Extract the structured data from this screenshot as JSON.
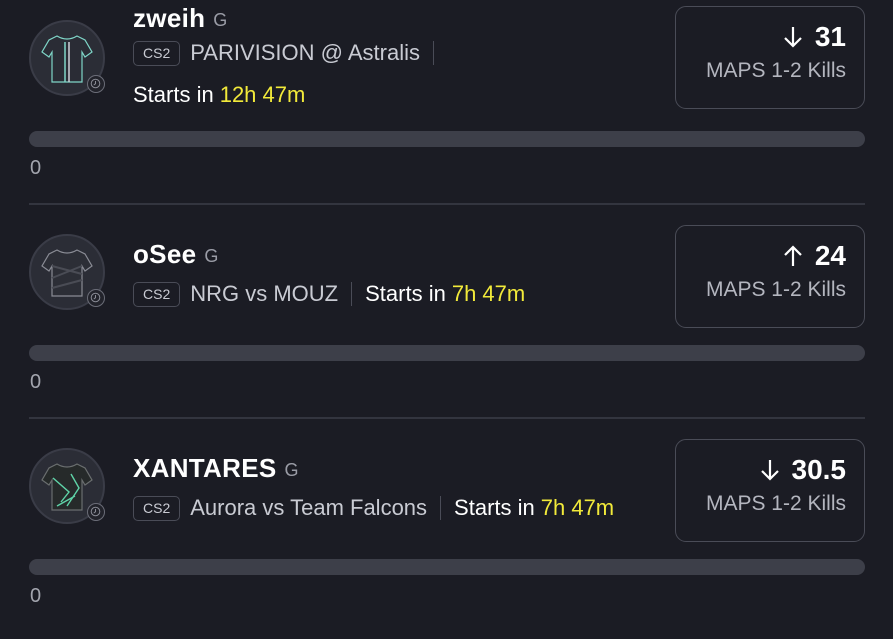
{
  "players": [
    {
      "name": "zweih",
      "position": "G",
      "game": "CS2",
      "matchup": "PARIVISION @ Astralis",
      "starts_label": "Starts in",
      "starts_time": "12h 47m",
      "direction": "down",
      "line": "31",
      "stat": "MAPS 1-2 Kills",
      "progress": 0,
      "count": "0",
      "jersey_colors": {
        "body": "#2a2c35",
        "accent": "#7fd6c8"
      }
    },
    {
      "name": "oSee",
      "position": "G",
      "game": "CS2",
      "matchup": "NRG vs MOUZ",
      "starts_label": "Starts in",
      "starts_time": "7h 47m",
      "direction": "up",
      "line": "24",
      "stat": "MAPS 1-2 Kills",
      "progress": 0,
      "count": "0",
      "jersey_colors": {
        "body": "#2c2e36",
        "accent": "#8a8c95"
      }
    },
    {
      "name": "XANTARES",
      "position": "G",
      "game": "CS2",
      "matchup": "Aurora vs Team Falcons",
      "starts_label": "Starts in",
      "starts_time": "7h 47m",
      "direction": "down",
      "line": "30.5",
      "stat": "MAPS 1-2 Kills",
      "progress": 0,
      "count": "0",
      "jersey_colors": {
        "body": "#262a2a",
        "accent": "#5fd4a8"
      }
    }
  ],
  "colors": {
    "highlight": "#f2ea3a",
    "background": "#1b1c24",
    "bar": "#3d3f49"
  }
}
